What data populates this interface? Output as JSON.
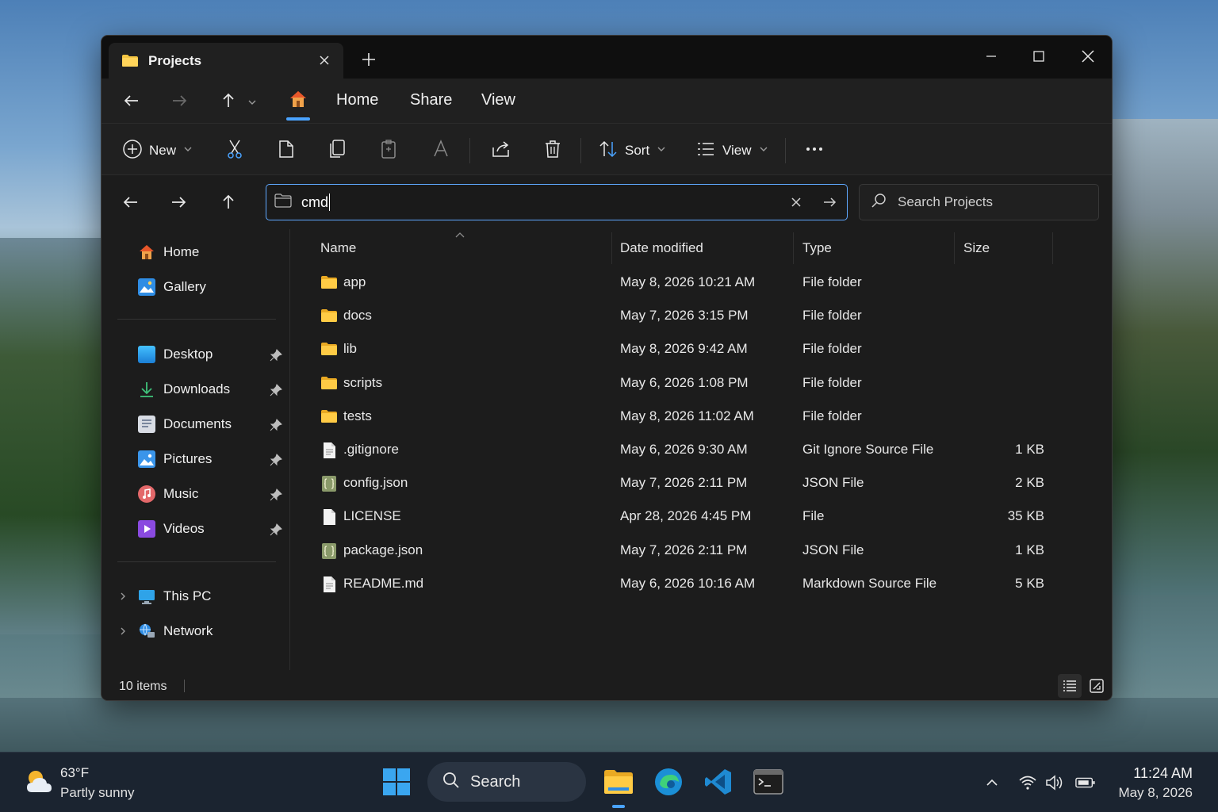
{
  "window": {
    "tab_title": "Projects",
    "menu": [
      "Home",
      "Share",
      "View"
    ]
  },
  "toolbar": {
    "new_label": "New",
    "sort_label": "Sort",
    "view_label": "View",
    "icons": [
      "cut-icon",
      "copy-icon",
      "copy-path-icon",
      "paste-icon",
      "rename-icon",
      "share-icon",
      "delete-icon",
      "more-icon"
    ]
  },
  "address": {
    "value": "cmd"
  },
  "search": {
    "placeholder": "Search Projects"
  },
  "sidebar": {
    "top": [
      {
        "label": "Home",
        "icon": "home-icon"
      },
      {
        "label": "Gallery",
        "icon": "gallery-icon"
      }
    ],
    "pinned": [
      {
        "label": "Desktop",
        "icon": "desktop-icon"
      },
      {
        "label": "Downloads",
        "icon": "downloads-icon"
      },
      {
        "label": "Documents",
        "icon": "documents-icon"
      },
      {
        "label": "Pictures",
        "icon": "pictures-icon"
      },
      {
        "label": "Music",
        "icon": "music-icon"
      },
      {
        "label": "Videos",
        "icon": "videos-icon"
      }
    ],
    "bottom": [
      {
        "label": "This PC",
        "icon": "this-pc-icon"
      },
      {
        "label": "Network",
        "icon": "network-icon"
      }
    ]
  },
  "columns": {
    "name": "Name",
    "date": "Date modified",
    "type": "Type",
    "size": "Size"
  },
  "files": [
    {
      "name": "app",
      "date": "May 8, 2026 10:21 AM",
      "type": "File folder",
      "size": "",
      "kind": "folder"
    },
    {
      "name": "docs",
      "date": "May 7, 2026 3:15 PM",
      "type": "File folder",
      "size": "",
      "kind": "folder"
    },
    {
      "name": "lib",
      "date": "May 8, 2026 9:42 AM",
      "type": "File folder",
      "size": "",
      "kind": "folder"
    },
    {
      "name": "scripts",
      "date": "May 6, 2026 1:08 PM",
      "type": "File folder",
      "size": "",
      "kind": "folder"
    },
    {
      "name": "tests",
      "date": "May 8, 2026 11:02 AM",
      "type": "File folder",
      "size": "",
      "kind": "folder"
    },
    {
      "name": ".gitignore",
      "date": "May 6, 2026 9:30 AM",
      "type": "Git Ignore Source File",
      "size": "1 KB",
      "kind": "text"
    },
    {
      "name": "config.json",
      "date": "May 7, 2026 2:11 PM",
      "type": "JSON File",
      "size": "2 KB",
      "kind": "json"
    },
    {
      "name": "LICENSE",
      "date": "Apr 28, 2026 4:45 PM",
      "type": "File",
      "size": "35 KB",
      "kind": "blank"
    },
    {
      "name": "package.json",
      "date": "May 7, 2026 2:11 PM",
      "type": "JSON File",
      "size": "1 KB",
      "kind": "json"
    },
    {
      "name": "README.md",
      "date": "May 6, 2026 10:16 AM",
      "type": "Markdown Source File",
      "size": "5 KB",
      "kind": "text"
    }
  ],
  "status": {
    "count": "10 items"
  },
  "taskbar": {
    "weather_temp": "63°F",
    "weather_desc": "Partly sunny",
    "search_label": "Search",
    "time": "11:24 AM",
    "date": "May 8, 2026",
    "apps": [
      "start-icon",
      "file-explorer-icon",
      "edge-icon",
      "vscode-icon",
      "terminal-icon"
    ]
  },
  "colors": {
    "accent": "#4aa3ff",
    "folder": "#f4c542",
    "window_bg": "#1c1c1c"
  }
}
